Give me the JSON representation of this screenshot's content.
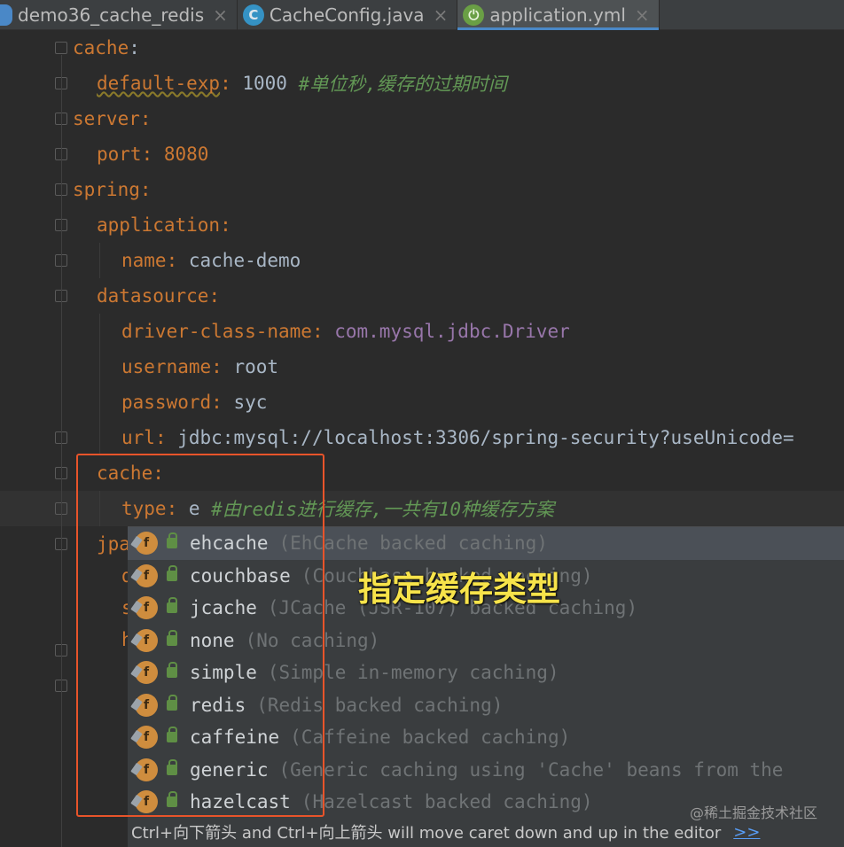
{
  "tabs": [
    {
      "label": "demo36_cache_redis",
      "icon": "folder-icon",
      "active": false
    },
    {
      "label": "CacheConfig.java",
      "icon": "java-class-icon",
      "icon_letter": "C",
      "active": false
    },
    {
      "label": "application.yml",
      "icon": "spring-icon",
      "active": true
    }
  ],
  "tab_close": "×",
  "lines": [
    {
      "k": "cache",
      "sep": ":"
    },
    {
      "k": "default-exp",
      "sep": ":",
      "v": " 1000 ",
      "c": "#单位秒,缓存的过期时间"
    },
    {
      "k": "server",
      "sep": ":"
    },
    {
      "k": "port",
      "sep": ":",
      "v": " 8080"
    },
    {
      "k": "spring",
      "sep": ":"
    },
    {
      "k": "application",
      "sep": ":"
    },
    {
      "k": "name",
      "sep": ":",
      "v": " cache-demo"
    },
    {
      "k": "datasource",
      "sep": ":"
    },
    {
      "k": "driver-class-name",
      "sep": ":",
      "v": " com.mysql.jdbc.Driver"
    },
    {
      "k": "username",
      "sep": ":",
      "v": " root"
    },
    {
      "k": "password",
      "sep": ":",
      "v": " syc"
    },
    {
      "k": "url",
      "sep": ":",
      "v": " jdbc:mysql://localhost:3306/spring-security?useUnicode="
    },
    {
      "k": "cache",
      "sep": ":"
    },
    {
      "k": "type",
      "sep": ":",
      "v": " e ",
      "c": "#由redis进行缓存,一共有10种缓存方案"
    },
    {
      "k": "jpa",
      "sep": ""
    },
    {
      "k": "d",
      "sep": ""
    },
    {
      "k": "s",
      "sep": ""
    },
    {
      "k": "h",
      "sep": ""
    }
  ],
  "completion": {
    "items": [
      {
        "name": "ehcache",
        "desc": "(EhCache backed caching)"
      },
      {
        "name": "couchbase",
        "desc": "(Couchbase backed caching)"
      },
      {
        "name": "jcache",
        "desc": "(JCache (JSR-107) backed caching)"
      },
      {
        "name": "none",
        "desc": "(No caching)"
      },
      {
        "name": "simple",
        "desc": "(Simple in-memory caching)"
      },
      {
        "name": "redis",
        "desc": "(Redis backed caching)"
      },
      {
        "name": "caffeine",
        "desc": "(Caffeine backed caching)"
      },
      {
        "name": "generic",
        "desc": "(Generic caching using 'Cache' beans from the"
      },
      {
        "name": "hazelcast",
        "desc": "(Hazelcast backed caching)"
      }
    ],
    "icon_letter": "f",
    "hint": "Ctrl+向下箭头 and Ctrl+向上箭头 will move caret down and up in the editor",
    "hint_link": ">>"
  },
  "annotation": "指定缓存类型",
  "watermark": "@稀土掘金技术社区",
  "colors": {
    "key": "#cc7832",
    "comment": "#629755",
    "annotation_box": "#e8542a",
    "annotation_text": "#f7e34a"
  }
}
